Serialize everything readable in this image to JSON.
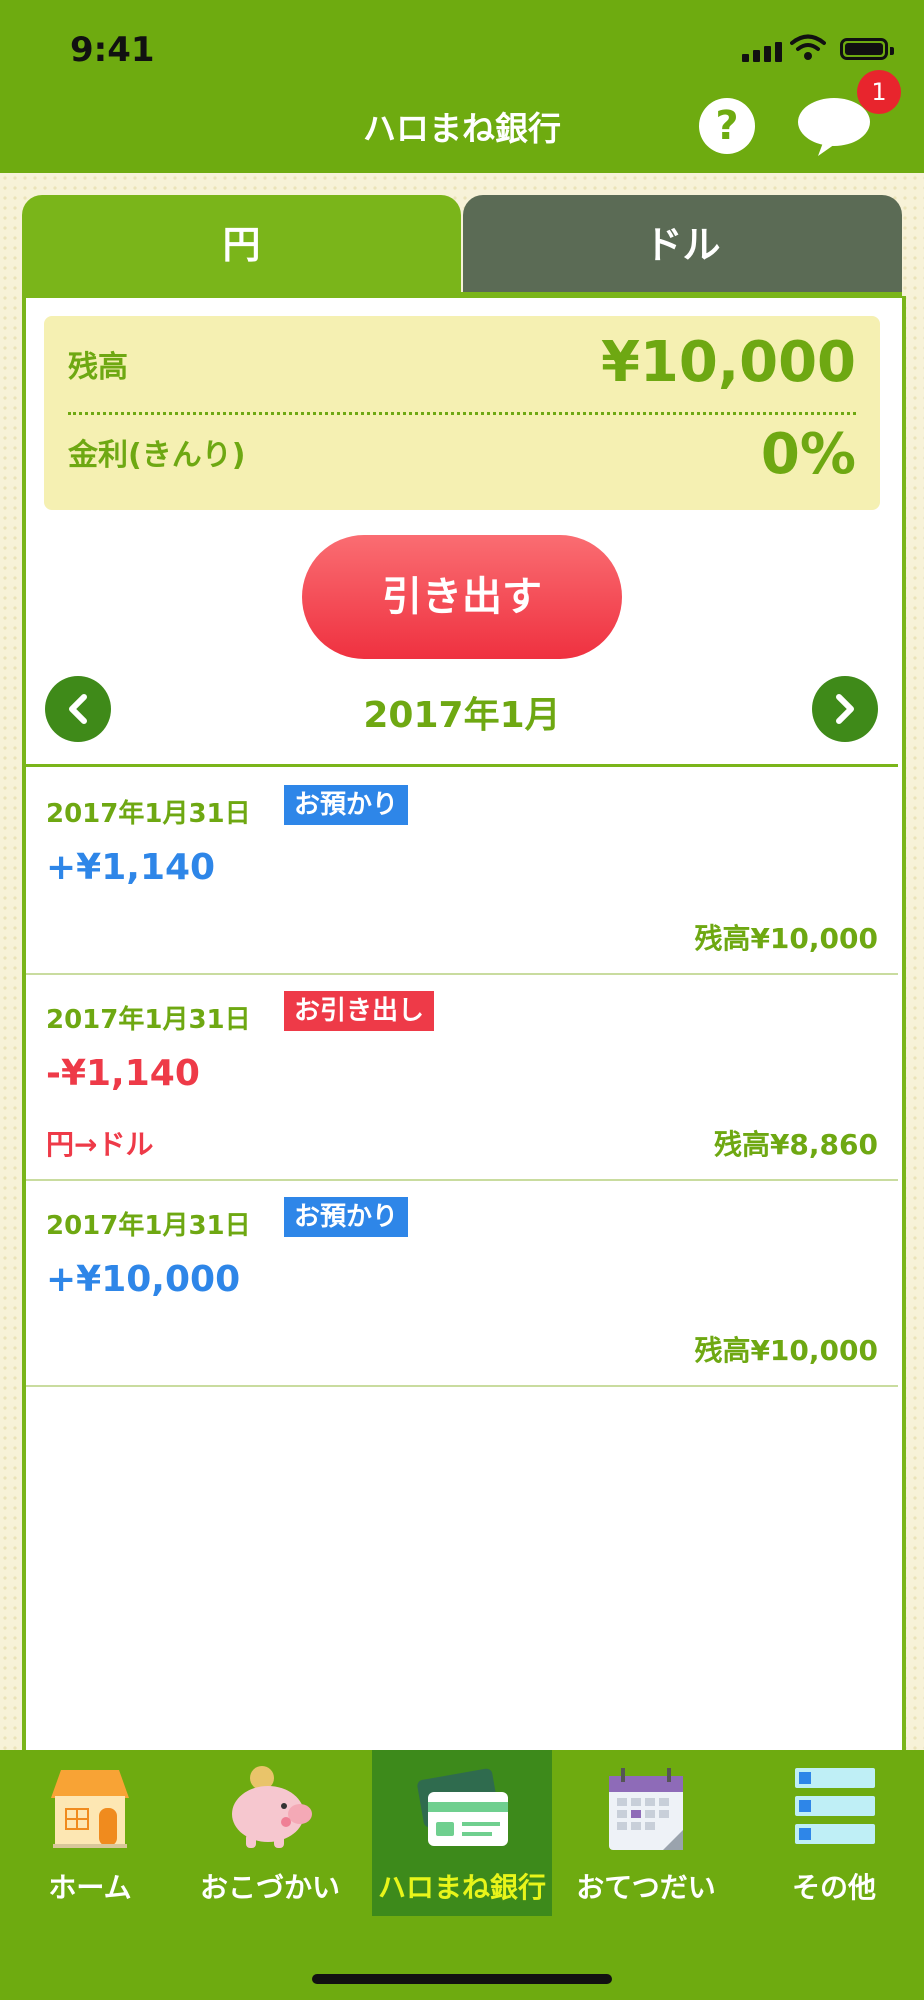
{
  "status_bar": {
    "time": "9:41"
  },
  "header": {
    "title": "ハロまね銀行",
    "help_icon": "?",
    "message_badge": "1"
  },
  "tabs": [
    {
      "label": "円",
      "selected": true
    },
    {
      "label": "ドル",
      "selected": false
    }
  ],
  "balance": {
    "balance_label": "残高",
    "balance_value": "¥10,000",
    "rate_label": "金利(きんり)",
    "rate_value": "0%"
  },
  "withdraw_button": "引き出す",
  "month_nav": {
    "month": "2017年1月"
  },
  "transactions": [
    {
      "date": "2017年1月31日",
      "tag": "お預かり",
      "amount": "+¥1,140",
      "note": "",
      "balance": "残高¥10,000"
    },
    {
      "date": "2017年1月31日",
      "tag": "お引き出し",
      "amount": "-¥1,140",
      "note": "円→ドル",
      "balance": "残高¥8,860"
    },
    {
      "date": "2017年1月31日",
      "tag": "お預かり",
      "amount": "+¥10,000",
      "note": "",
      "balance": "残高¥10,000"
    }
  ],
  "bottom_nav": [
    {
      "label": "ホーム",
      "icon": "house-icon"
    },
    {
      "label": "おこづかい",
      "icon": "piggy-bank-icon"
    },
    {
      "label": "ハロまね銀行",
      "icon": "bank-card-icon",
      "active": true
    },
    {
      "label": "おてつだい",
      "icon": "calendar-icon"
    },
    {
      "label": "その他",
      "icon": "list-icon"
    }
  ],
  "colors": {
    "header_green": "#6eab10",
    "deposit_blue": "#2e86e8",
    "withdraw_red": "#ee3a48",
    "active_nav": "#3d8a1b"
  }
}
